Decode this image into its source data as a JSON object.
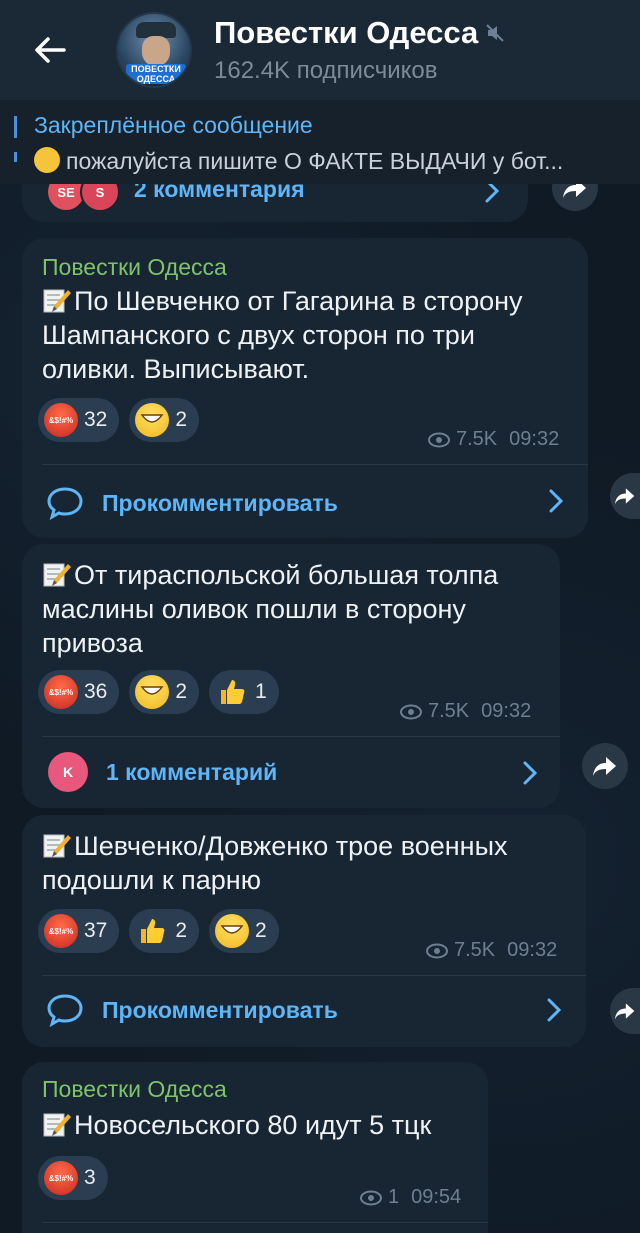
{
  "header": {
    "title": "Повестки Одесса",
    "subscribers": "162.4K подписчиков",
    "avatar_text_1": "ПОВЕСТКИ",
    "avatar_text_2": "ОДЕССА"
  },
  "pinned": {
    "title": "Закреплённое сообщение",
    "text": "пожалуйста пишите О ФАКТЕ ВЫДАЧИ у бот..."
  },
  "top_partial": {
    "avatar1": "SE",
    "avatar2": "S",
    "comments": "2 комментария"
  },
  "messages": [
    {
      "author": "Повестки Одесса",
      "text": "По Шевченко от Гагарина в сторону Шампанского с двух сторон по три оливки. Выписывают.",
      "reactions": [
        {
          "emoji": "angry",
          "count": "32"
        },
        {
          "emoji": "grin",
          "count": "2"
        }
      ],
      "views": "7.5K",
      "time": "09:32",
      "comment_label": "Прокомментировать"
    },
    {
      "text": "От тираспольской большая толпа маслины оливок пошли в сторону привоза",
      "reactions": [
        {
          "emoji": "angry",
          "count": "36"
        },
        {
          "emoji": "grin",
          "count": "2"
        },
        {
          "emoji": "thumb",
          "count": "1"
        }
      ],
      "views": "7.5K",
      "time": "09:32",
      "comment_avatar": "K",
      "comment_label": "1 комментарий"
    },
    {
      "text": "Шевченко/Довженко трое военных подошли к парню",
      "reactions": [
        {
          "emoji": "angry",
          "count": "37"
        },
        {
          "emoji": "thumb",
          "count": "2"
        },
        {
          "emoji": "grin",
          "count": "2"
        }
      ],
      "views": "7.5K",
      "time": "09:32",
      "comment_label": "Прокомментировать"
    },
    {
      "author": "Повестки Одесса",
      "text": "Новосельского 80 идут 5 тцк",
      "reactions": [
        {
          "emoji": "angry",
          "count": "3"
        }
      ],
      "views": "1",
      "time": "09:54"
    }
  ],
  "angry_label": "&$!#%",
  "colors": {
    "accent": "#5eb5f7",
    "author": "#7fc36b",
    "bubble": "#182533",
    "background": "#0e1621"
  }
}
